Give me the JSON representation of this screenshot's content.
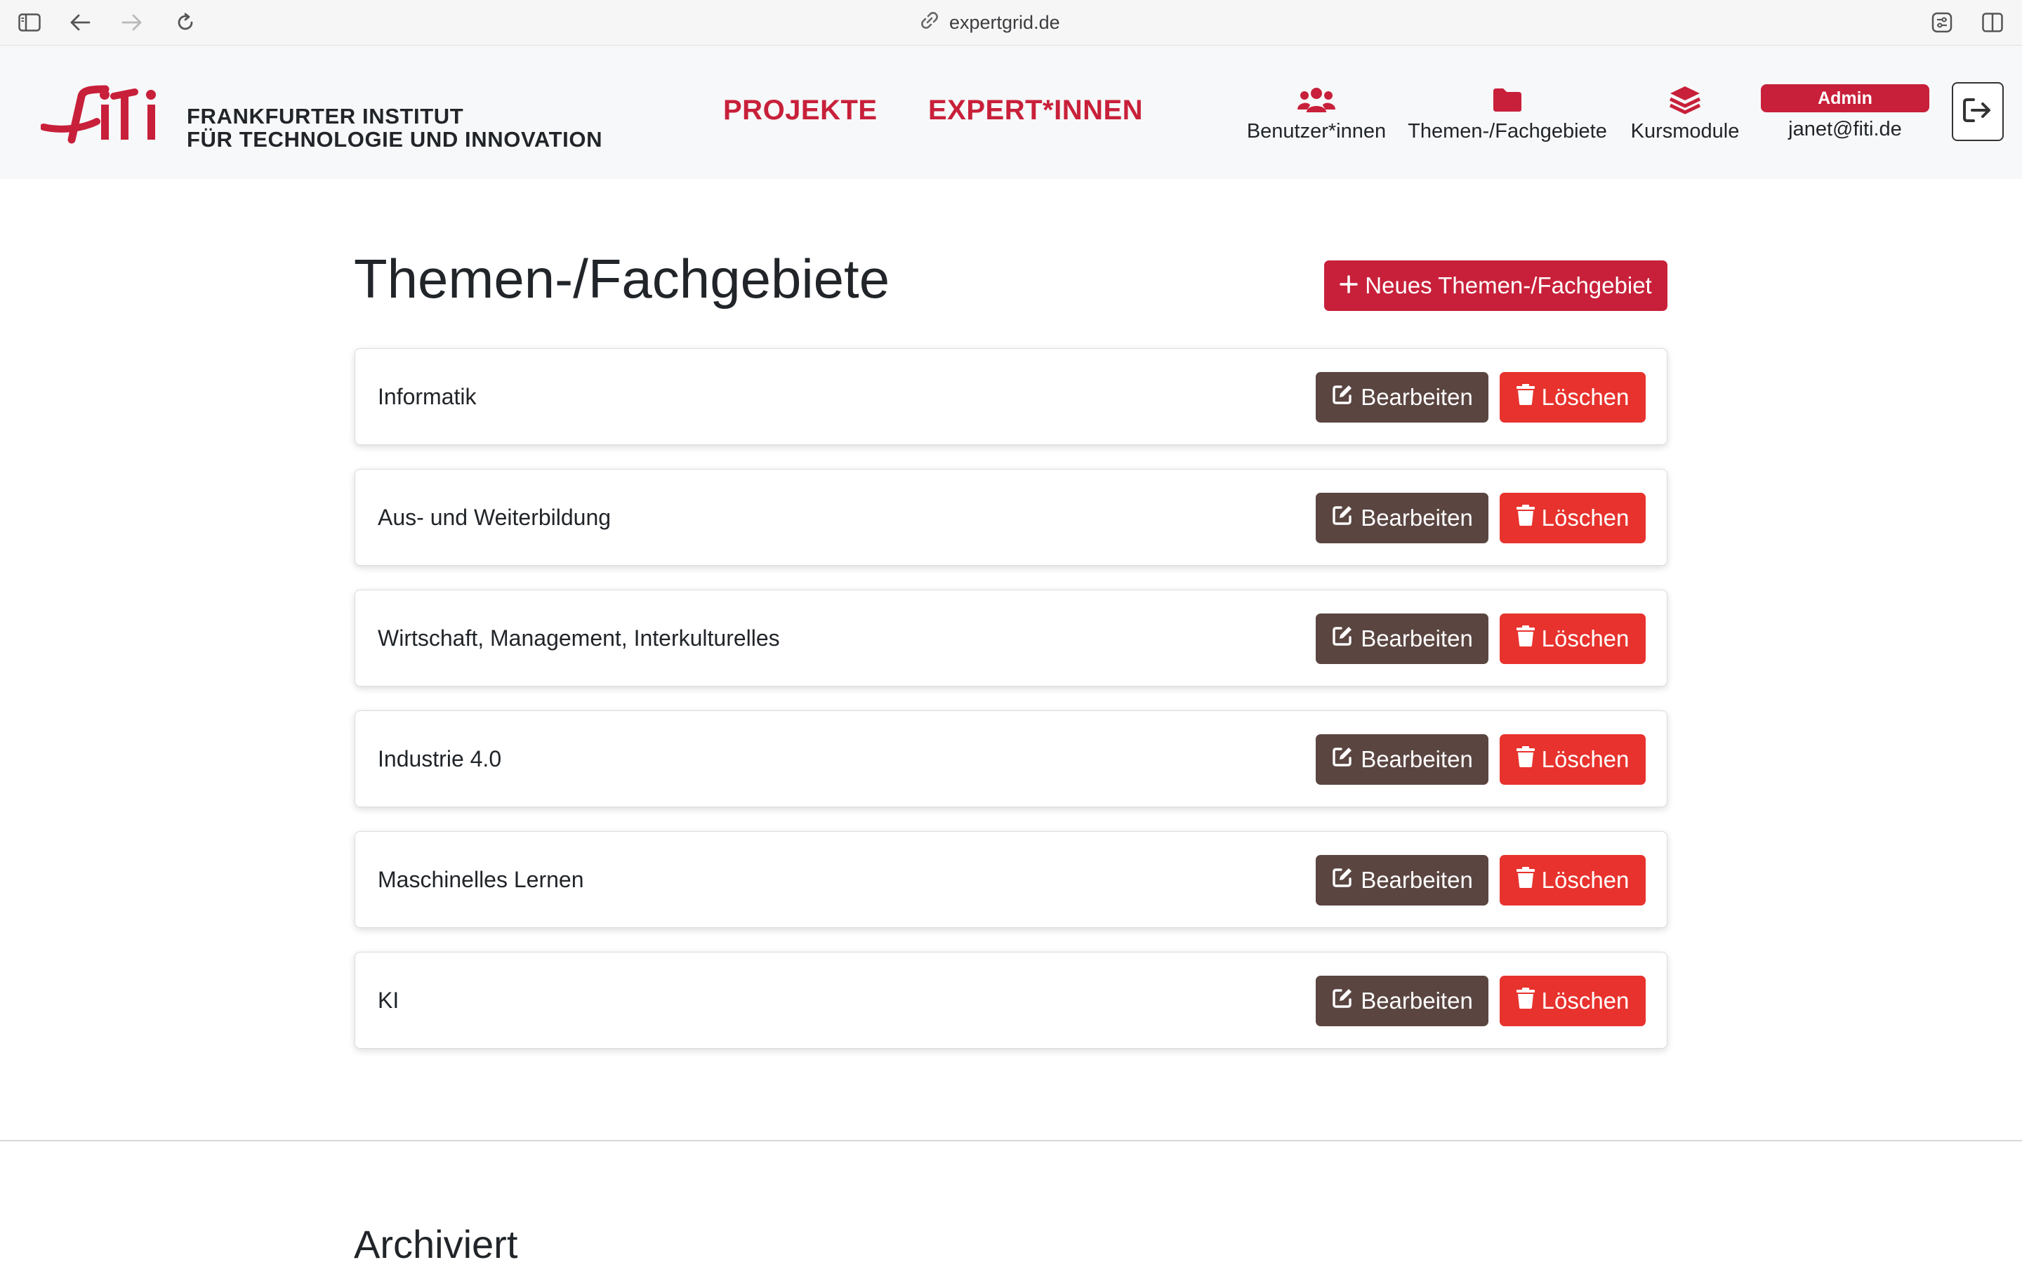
{
  "browser": {
    "url": "expertgrid.de",
    "icons": [
      "sidebar-icon",
      "back-arrow-icon",
      "forward-arrow-icon",
      "reload-icon",
      "link-icon",
      "extension-icon",
      "split-view-icon"
    ]
  },
  "header": {
    "logo_line1": "FRANKFURTER INSTITUT",
    "logo_line2": "FÜR TECHNOLOGIE UND INNOVATION",
    "nav_projekte": "PROJEKTE",
    "nav_experts": "EXPERT*INNEN",
    "nav_users": "Benutzer*innen",
    "nav_topics": "Themen-/Fachgebiete",
    "nav_modules": "Kursmodule",
    "role_badge": "Admin",
    "user_email": "janet@fiti.de",
    "brand_color": "#c8203a"
  },
  "main": {
    "title": "Themen-/Fachgebiete",
    "new_button": "Neues Themen-/Fachgebiet",
    "edit_label": "Bearbeiten",
    "delete_label": "Löschen",
    "topics": [
      "Informatik",
      "Aus- und Weiterbildung",
      "Wirtschaft, Management, Interkulturelles",
      "Industrie 4.0",
      "Maschinelles Lernen",
      "KI"
    ],
    "archived_title": "Archiviert"
  },
  "colors": {
    "edit_button": "#5a4541",
    "delete_button": "#e8322d"
  }
}
